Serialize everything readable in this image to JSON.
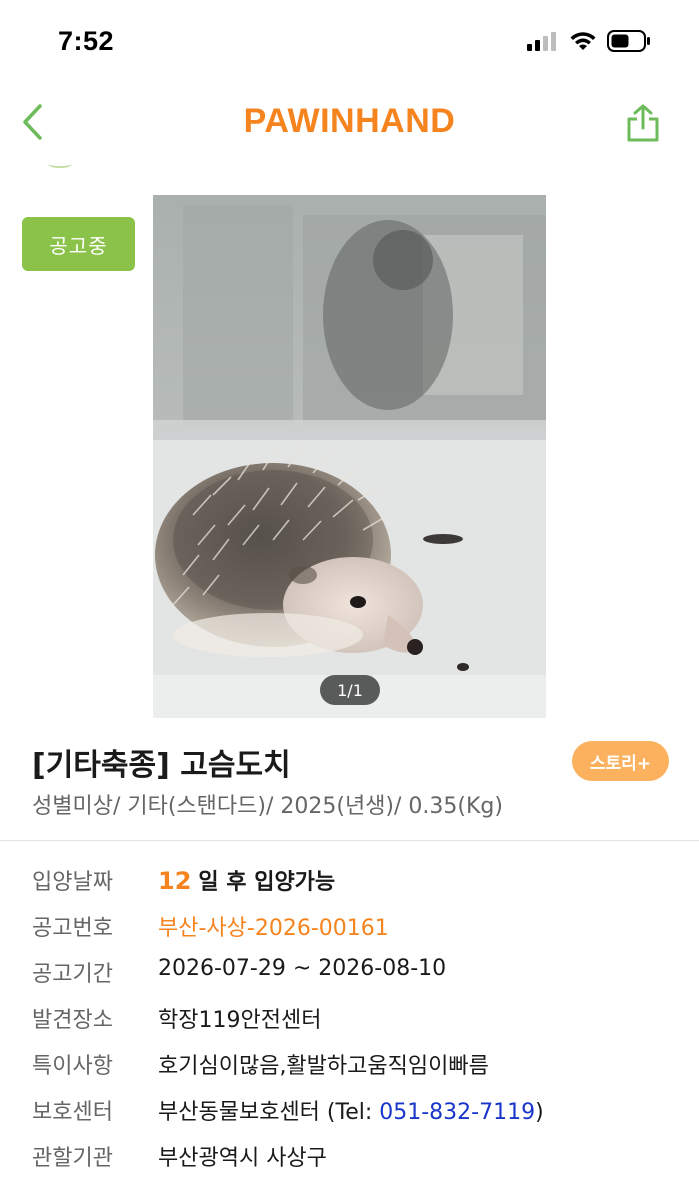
{
  "status_bar": {
    "time": "7:52",
    "icons": [
      "signal-icon",
      "wifi-icon",
      "battery-icon"
    ]
  },
  "nav": {
    "back_icon": "chevron-left-icon",
    "brand": "PAWINHAND",
    "share_icon": "share-icon"
  },
  "colors": {
    "brand": "#f5841f",
    "accent_green": "#8bc34a",
    "story_button": "#fbb15e",
    "link_blue": "#1a35c9"
  },
  "listing": {
    "status_badge": "공고중",
    "photo_counter": "1/1",
    "title": "[기타축종] 고슴도치",
    "story_button": "스토리+",
    "subtitle": "성별미상/ 기타(스탠다드)/ 2025(년생)/ 0.35(Kg)"
  },
  "details": {
    "adoption_date": {
      "label": "입양날짜",
      "days": "12",
      "suffix": "일 후 입양가능"
    },
    "notice_number": {
      "label": "공고번호",
      "value": "부산-사상-2026-00161"
    },
    "notice_period": {
      "label": "공고기간",
      "value": "2026-07-29 ~ 2026-08-10"
    },
    "found_place": {
      "label": "발견장소",
      "value": "학장119안전센터"
    },
    "characteristics": {
      "label": "특이사항",
      "value": "호기심이많음,활발하고움직임이빠름"
    },
    "shelter": {
      "label": "보호센터",
      "name": "부산동물보호센터 (Tel: ",
      "tel": "051-832-7119",
      "close": ")"
    },
    "authority": {
      "label": "관할기관",
      "value": "부산광역시 사상구"
    }
  }
}
